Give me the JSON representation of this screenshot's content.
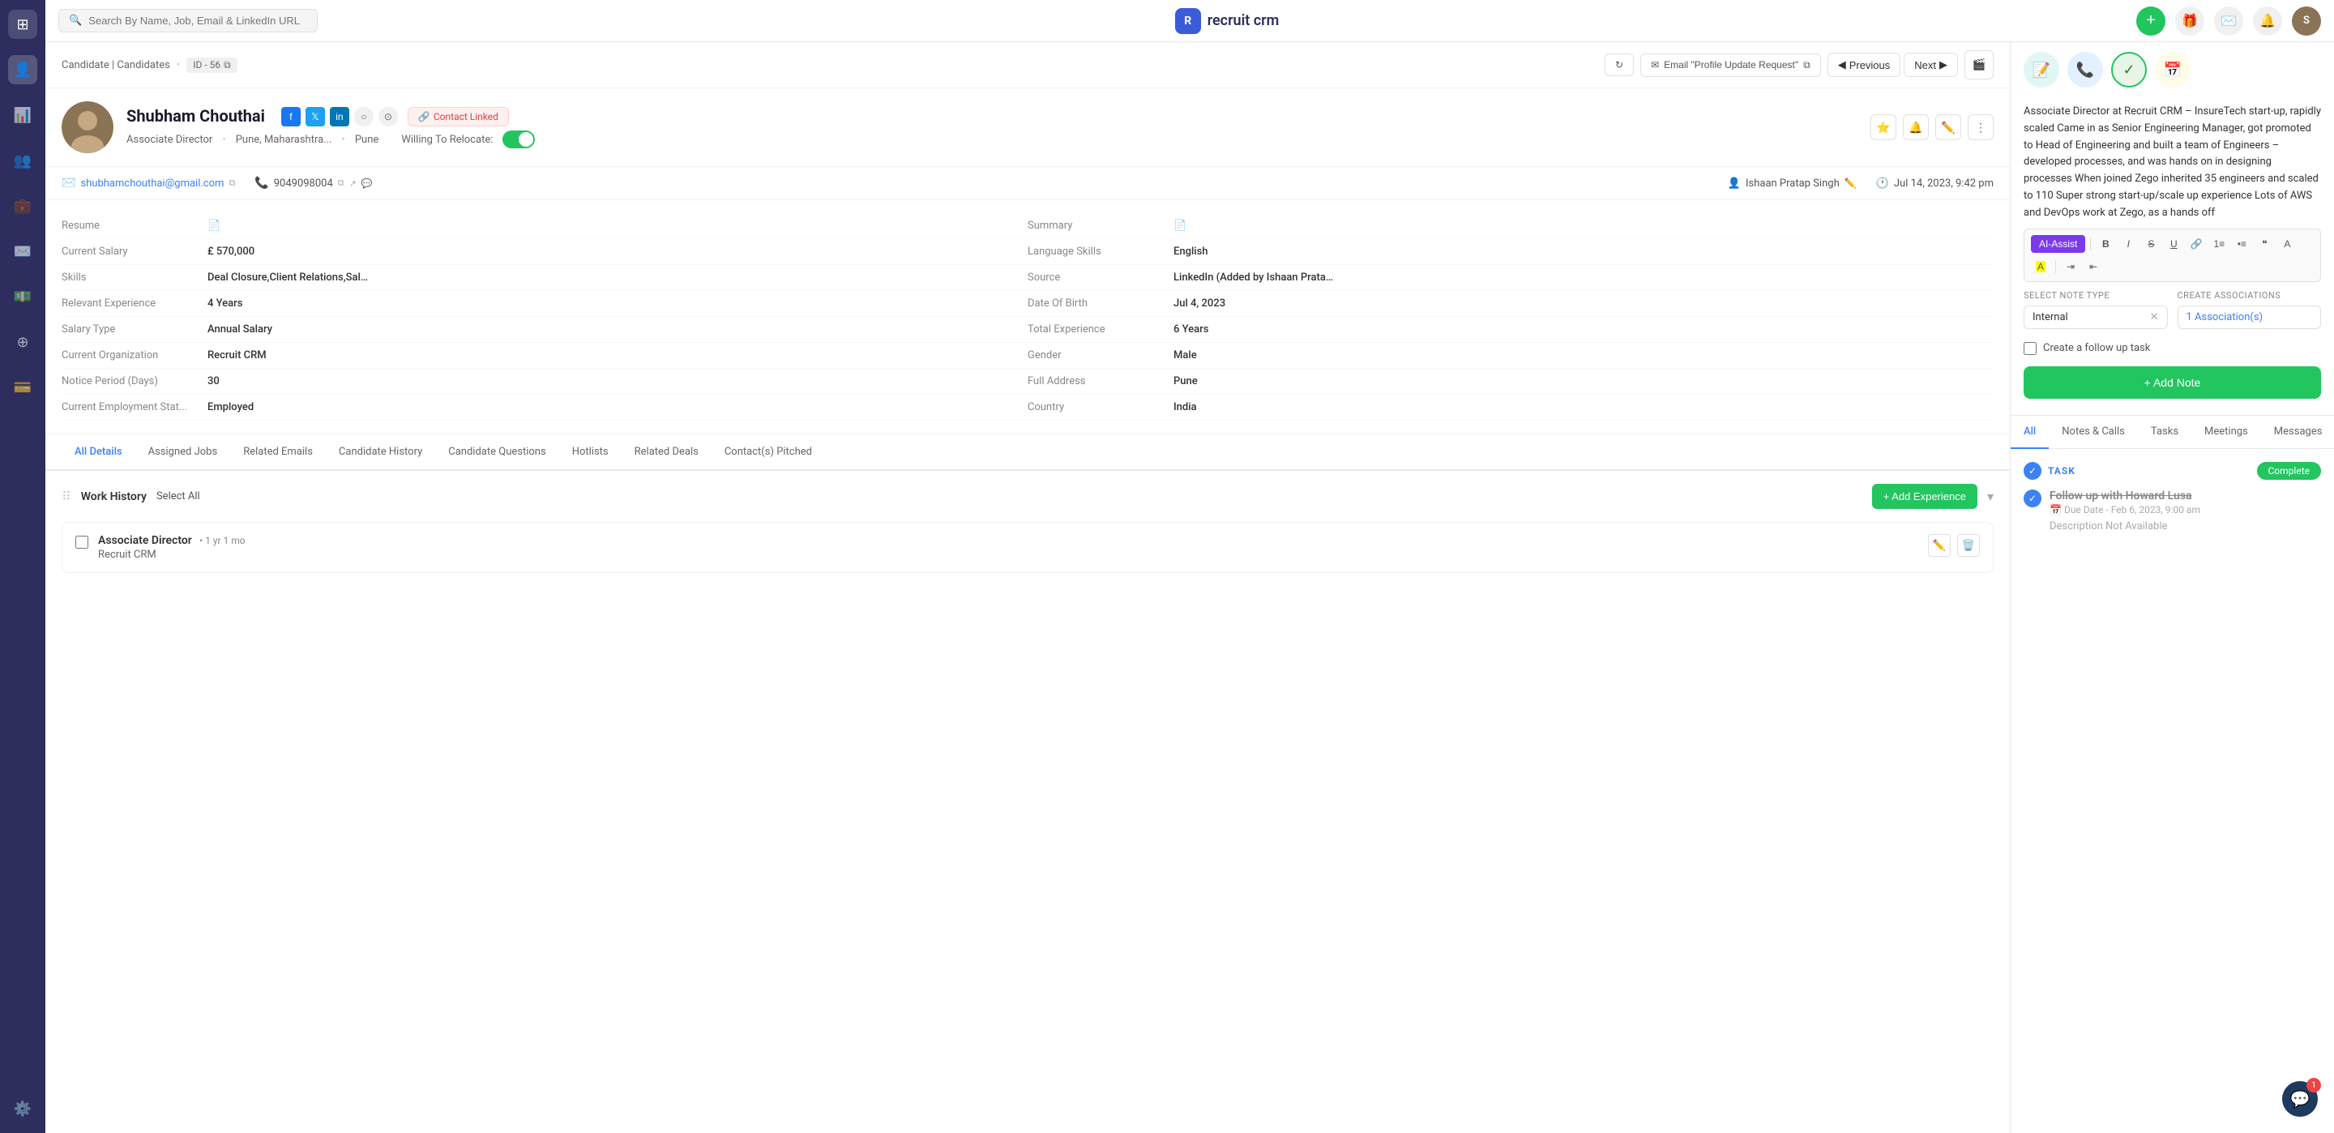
{
  "app": {
    "logo_text": "recruit crm",
    "search_placeholder": "Search By Name, Job, Email & LinkedIn URL"
  },
  "breadcrumb": {
    "path": "Candidate | Candidates",
    "separator": "•",
    "id_label": "ID - 56"
  },
  "action_bar": {
    "email_label": "Email \"Profile Update Request\"",
    "previous_label": "Previous",
    "next_label": "Next"
  },
  "candidate": {
    "name": "Shubham Chouthai",
    "title": "Associate Director",
    "location": "Pune, Maharashtra...",
    "city": "Pune",
    "willing_to_relocate": "Willing To Relocate:",
    "contact_linked": "Contact Linked",
    "email": "shubhamchouthai@gmail.com",
    "phone": "9049098004",
    "owner": "Ishaan Pratap Singh",
    "timestamp": "Jul 14, 2023, 9:42 pm",
    "details": {
      "resume_label": "Resume",
      "current_salary_label": "Current Salary",
      "current_salary_value": "£ 570,000",
      "skills_label": "Skills",
      "skills_value": "Deal Closure,Client Relations,Sales Mana...",
      "relevant_exp_label": "Relevant Experience",
      "relevant_exp_value": "4 Years",
      "salary_type_label": "Salary Type",
      "salary_type_value": "Annual Salary",
      "current_org_label": "Current Organization",
      "current_org_value": "Recruit CRM",
      "notice_period_label": "Notice Period (Days)",
      "notice_period_value": "30",
      "emp_status_label": "Current Employment Stat...",
      "emp_status_value": "Employed",
      "summary_label": "Summary",
      "language_label": "Language Skills",
      "language_value": "English",
      "source_label": "Source",
      "source_value": "LinkedIn (Added by Ishaan Pratap Singh)",
      "dob_label": "Date Of Birth",
      "dob_value": "Jul 4, 2023",
      "total_exp_label": "Total Experience",
      "total_exp_value": "6 Years",
      "gender_label": "Gender",
      "gender_value": "Male",
      "full_address_label": "Full Address",
      "full_address_value": "Pune",
      "country_label": "Country",
      "country_value": "India"
    }
  },
  "tabs": [
    {
      "label": "All Details",
      "active": true
    },
    {
      "label": "Assigned Jobs",
      "active": false
    },
    {
      "label": "Related Emails",
      "active": false
    },
    {
      "label": "Candidate History",
      "active": false
    },
    {
      "label": "Candidate Questions",
      "active": false
    },
    {
      "label": "Hotlists",
      "active": false
    },
    {
      "label": "Related Deals",
      "active": false
    },
    {
      "label": "Contact(s) Pitched",
      "active": false
    }
  ],
  "work_history": {
    "section_title": "Work History",
    "select_all": "Select All",
    "add_exp_label": "+ Add Experience",
    "items": [
      {
        "title": "Associate Director",
        "duration": "• 1 yr 1 mo",
        "company": "Recruit CRM"
      }
    ]
  },
  "right_panel": {
    "note_text": "Associate Director at Recruit CRM – InsureTech start-up, rapidly scaled\nCame in as Senior Engineering Manager, got promoted to Head of Engineering and built a team of Engineers – developed processes, and was hands on in designing processes\nWhen joined Zego inherited 35 engineers and scaled to 110\nSuper strong start-up/scale up experience\nLots of AWS and DevOps work at Zego, as a hands off",
    "ai_assist_label": "AI-Assist",
    "note_type": {
      "label": "Select Note Type",
      "value": "Internal",
      "assoc_label": "Create associations",
      "assoc_value": "1 Association(s)"
    },
    "followup_label": "Create a follow up task",
    "add_note_label": "+ Add Note"
  },
  "activity_tabs": [
    {
      "label": "All",
      "active": true
    },
    {
      "label": "Notes & Calls",
      "active": false
    },
    {
      "label": "Tasks",
      "active": false
    },
    {
      "label": "Meetings",
      "active": false
    },
    {
      "label": "Messages",
      "active": false
    }
  ],
  "task": {
    "label": "TASK",
    "complete_label": "Complete",
    "title": "Follow up with Howard Lusa",
    "due_label": "Due Date - Feb 6, 2023, 9:00 am",
    "description": "Description Not Available"
  },
  "chat": {
    "badge": "1"
  },
  "sidebar_icons": [
    "grid",
    "person",
    "chart",
    "people",
    "briefcase",
    "mail",
    "dollar",
    "plus-circle",
    "card",
    "settings"
  ]
}
